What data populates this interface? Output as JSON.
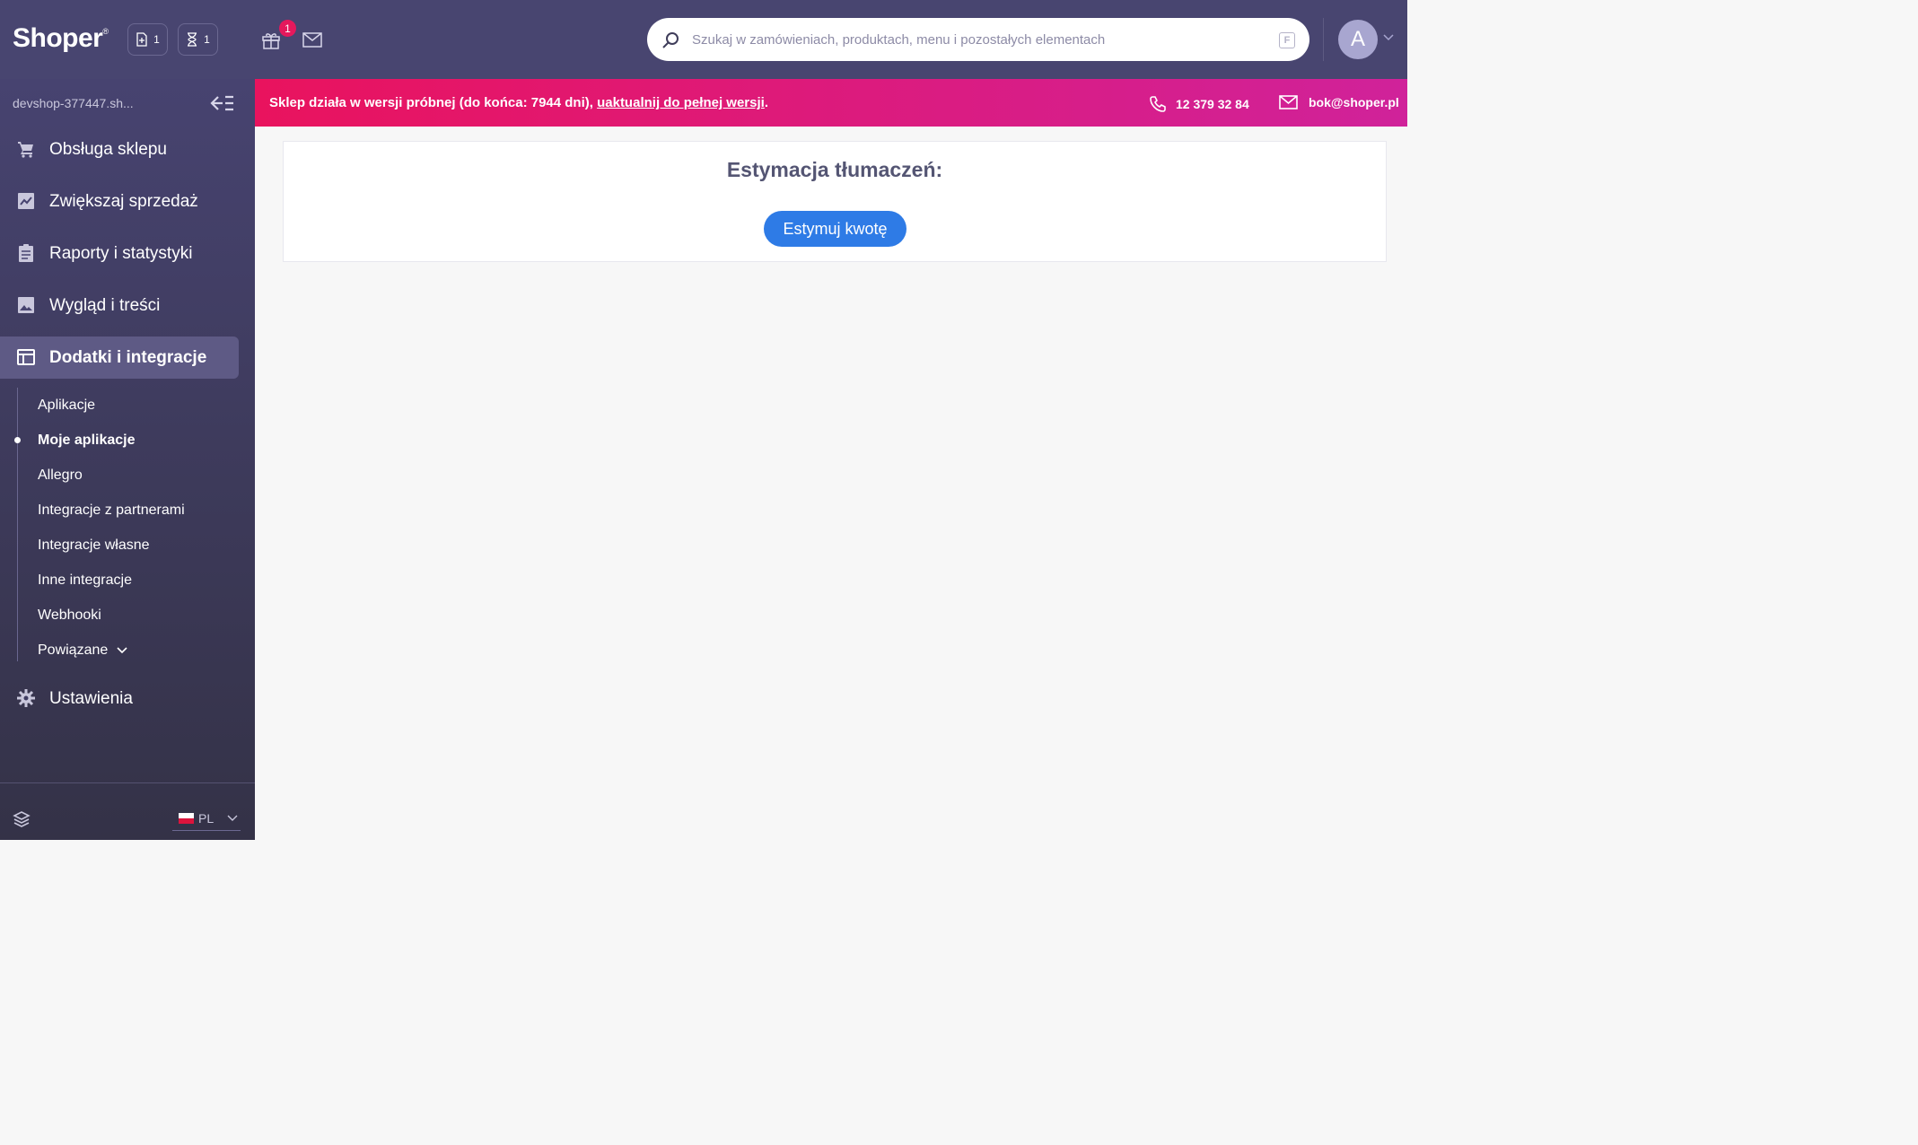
{
  "header": {
    "logo": "Shoper",
    "logo_mark": "®",
    "orders_count": "1",
    "pending_count": "1",
    "gift_badge": "1",
    "search_placeholder": "Szukaj w zamówieniach, produktach, menu i pozostałych elementach",
    "avatar_initial": "A"
  },
  "sidebar": {
    "shop_name": "devshop-377447.sh...",
    "items": [
      {
        "label": "Obsługa sklepu",
        "icon": "cart-icon"
      },
      {
        "label": "Zwiększaj sprzedaż",
        "icon": "chart-icon"
      },
      {
        "label": "Raporty i statystyki",
        "icon": "clipboard-icon"
      },
      {
        "label": "Wygląd i treści",
        "icon": "image-icon"
      },
      {
        "label": "Dodatki i integracje",
        "icon": "window-icon"
      },
      {
        "label": "Ustawienia",
        "icon": "gear-icon"
      }
    ],
    "sub_items": [
      "Aplikacje",
      "Moje aplikacje",
      "Allegro",
      "Integracje z partnerami",
      "Integracje własne",
      "Inne integracje",
      "Webhooki",
      "Powiązane"
    ],
    "language": "PL"
  },
  "banner": {
    "message_prefix": "Sklep działa w wersji próbnej (do końca: 7944 dni), ",
    "upgrade_link": "uaktualnij do pełnej wersji",
    "message_suffix": ".",
    "phone": "12 379 32 84",
    "email": "bok@shoper.pl"
  },
  "main": {
    "title": "Estymacja tłumaczeń:",
    "estimate_button": "Estymuj kwotę"
  },
  "colors": {
    "header_bg": "#484570",
    "banner_start": "#e9135e",
    "banner_end": "#d0229a",
    "primary_button": "#2e7be6",
    "badge": "#e5185c"
  }
}
